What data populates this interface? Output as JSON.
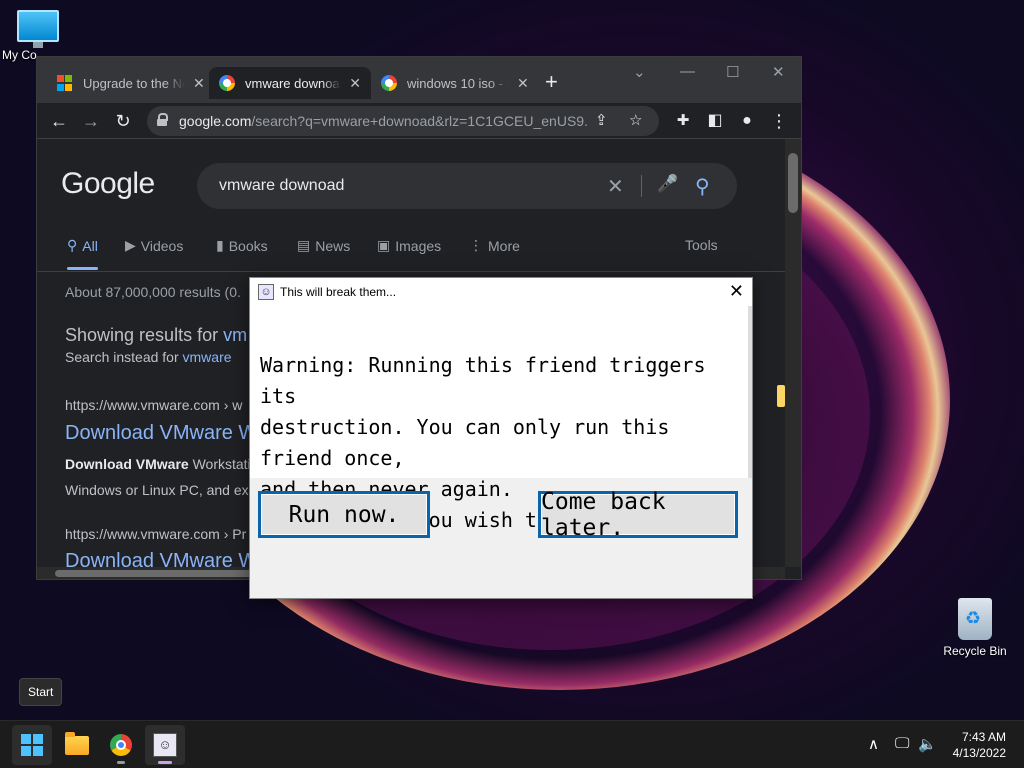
{
  "desktop": {
    "icons": [
      {
        "label": "My Co",
        "icon": "computer-icon"
      },
      {
        "label": "Recycle Bin",
        "icon": "recycle-bin-icon"
      }
    ]
  },
  "browser": {
    "tabs": [
      {
        "title": "Upgrade to the Ne",
        "icon": "microsoft-logo-icon",
        "close": "✕"
      },
      {
        "title": "vmware downoad",
        "icon": "google-favicon-icon",
        "close": "✕"
      },
      {
        "title": "windows 10 iso - G",
        "icon": "google-favicon-icon",
        "close": "✕"
      }
    ],
    "new_tab": "+",
    "window_controls": {
      "chevron": "⌄",
      "minimize": "—",
      "maximize": "☐",
      "close": "✕"
    },
    "nav": {
      "back": "←",
      "forward": "→",
      "reload": "↻"
    },
    "url_host": "google.com",
    "url_rest": "/search?q=vmware+downoad&rlz=1C1GCEU_enUS9...",
    "toolbar_icons": {
      "share": "⇪",
      "bookmark": "☆",
      "extensions": "✚",
      "sidepanel": "◧",
      "profile": "●",
      "menu": "⋮"
    }
  },
  "search_page": {
    "logo": "Google",
    "query": "vmware downoad",
    "clear": "✕",
    "mic": "🎤",
    "search": "⚲",
    "tabs": [
      {
        "label": "All",
        "icon": "⚲"
      },
      {
        "label": "Videos",
        "icon": "▶"
      },
      {
        "label": "Books",
        "icon": "▮"
      },
      {
        "label": "News",
        "icon": "▤"
      },
      {
        "label": "Images",
        "icon": "▣"
      },
      {
        "label": "More",
        "icon": "⋮"
      }
    ],
    "tools": "Tools",
    "stats": "About 87,000,000 results (0.",
    "showing_prefix": "Showing results for ",
    "showing_link": "vm",
    "instead_prefix": "Search instead for ",
    "instead_link": "vmware",
    "results": [
      {
        "url": "https://www.vmware.com › w",
        "title": "Download VMware W",
        "snippet_bold": "Download VMware",
        "snippet_rest": " Workstatio",
        "snippet_line2": "Windows or Linux PC, and exp"
      },
      {
        "url": "https://www.vmware.com › Pr",
        "title": "Download VMware W"
      }
    ]
  },
  "dialog": {
    "title": "This will break them...",
    "close": "✕",
    "message": "Warning: Running this friend triggers its\ndestruction. You can only run this friend once,\nand then never again.\nAre you sure you wish to run them now?",
    "run_button": "Run now.",
    "later_button": "Come back later."
  },
  "tooltip": "Start",
  "taskbar": {
    "tray": {
      "chevron": "∧",
      "network": "🖵",
      "volume": "🔈"
    },
    "time": "7:43 AM",
    "date": "4/13/2022"
  }
}
